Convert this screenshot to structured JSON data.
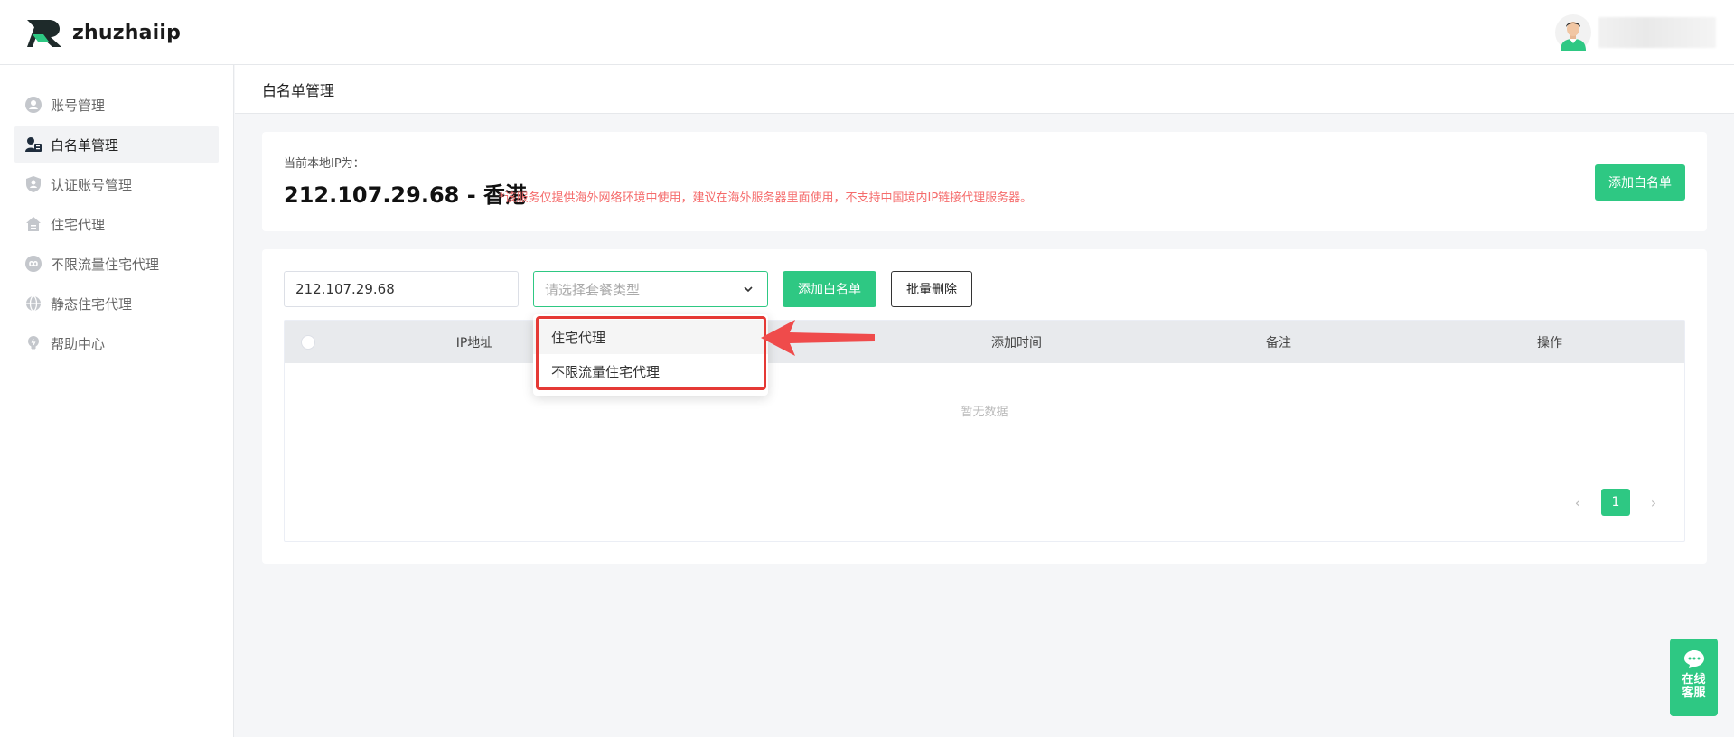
{
  "brand": {
    "name": "zhuzhaiip"
  },
  "sidebar": {
    "items": [
      {
        "label": "账号管理",
        "icon": "user-icon",
        "active": false
      },
      {
        "label": "白名单管理",
        "icon": "user-list-icon",
        "active": true
      },
      {
        "label": "认证账号管理",
        "icon": "shield-user-icon",
        "active": false
      },
      {
        "label": "住宅代理",
        "icon": "house-icon",
        "active": false
      },
      {
        "label": "不限流量住宅代理",
        "icon": "infinity-icon",
        "active": false
      },
      {
        "label": "静态住宅代理",
        "icon": "globe-icon",
        "active": false
      },
      {
        "label": "帮助中心",
        "icon": "bulb-icon",
        "active": false
      }
    ]
  },
  "page": {
    "title": "白名单管理"
  },
  "ip_card": {
    "label": "当前本地IP为：",
    "value": "212.107.29.68 - 香港",
    "warning": "*该服务仅提供海外网络环境中使用，建议在海外服务器里面使用，不支持中国境内IP链接代理服务器。",
    "add_button": "添加白名单"
  },
  "form": {
    "ip_input_value": "212.107.29.68",
    "select_placeholder": "请选择套餐类型",
    "add_button": "添加白名单",
    "batch_delete_button": "批量删除"
  },
  "dropdown": {
    "options": [
      "住宅代理",
      "不限流量住宅代理"
    ]
  },
  "table": {
    "columns": [
      "IP地址",
      "添加时间",
      "备注",
      "操作"
    ],
    "empty_text": "暂无数据"
  },
  "pagination": {
    "current_page": "1",
    "prev": "‹",
    "next": "›"
  },
  "chat": {
    "label": "在线客服"
  },
  "colors": {
    "accent": "#2ec883",
    "warning": "#f56c6c",
    "highlight": "#e53935"
  }
}
